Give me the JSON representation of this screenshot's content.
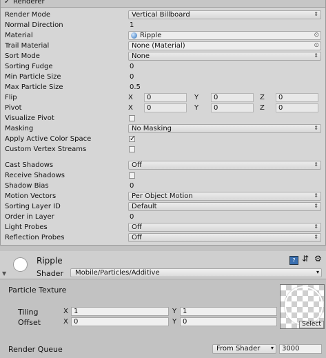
{
  "header": {
    "title": "Renderer",
    "checked": "✓"
  },
  "rows": [
    {
      "label": "Render Mode",
      "kind": "dropdown",
      "value": "Vertical Billboard"
    },
    {
      "label": "Normal Direction",
      "kind": "text",
      "value": "1"
    },
    {
      "label": "Material",
      "kind": "object",
      "value": "Ripple"
    },
    {
      "label": "Trail Material",
      "kind": "object",
      "value": "None (Material)"
    },
    {
      "label": "Sort Mode",
      "kind": "dropdown",
      "value": "None"
    },
    {
      "label": "Sorting Fudge",
      "kind": "text",
      "value": "0"
    },
    {
      "label": "Min Particle Size",
      "kind": "text",
      "value": "0"
    },
    {
      "label": "Max Particle Size",
      "kind": "text",
      "value": "0.5"
    },
    {
      "label": "Flip",
      "kind": "xyz",
      "x": "0",
      "y": "0",
      "z": "0"
    },
    {
      "label": "Pivot",
      "kind": "xyz",
      "x": "0",
      "y": "0",
      "z": "0"
    },
    {
      "label": "Visualize Pivot",
      "kind": "checkbox",
      "value": ""
    },
    {
      "label": "Masking",
      "kind": "dropdown",
      "value": "No Masking"
    },
    {
      "label": "Apply Active Color Space",
      "kind": "checkbox",
      "value": "✓"
    },
    {
      "label": "Custom Vertex Streams",
      "kind": "checkbox",
      "value": ""
    },
    {
      "label": "Cast Shadows",
      "kind": "dropdown",
      "value": "Off"
    },
    {
      "label": "Receive Shadows",
      "kind": "checkbox",
      "value": ""
    },
    {
      "label": "Shadow Bias",
      "kind": "text",
      "value": "0"
    },
    {
      "label": "Motion Vectors",
      "kind": "dropdown",
      "value": "Per Object Motion"
    },
    {
      "label": "Sorting Layer ID",
      "kind": "dropdown",
      "value": "Default"
    },
    {
      "label": "Order in Layer",
      "kind": "text",
      "value": "0"
    },
    {
      "label": "Light Probes",
      "kind": "dropdown",
      "value": "Off"
    },
    {
      "label": "Reflection Probes",
      "kind": "dropdown",
      "value": "Off"
    }
  ],
  "axis": {
    "x": "X",
    "y": "Y",
    "z": "Z"
  },
  "material": {
    "name": "Ripple",
    "shader_label": "Shader",
    "shader_value": "Mobile/Particles/Additive",
    "texture_label": "Particle Texture",
    "tiling_label": "Tiling",
    "tiling_x": "1",
    "tiling_y": "1",
    "offset_label": "Offset",
    "offset_x": "0",
    "offset_y": "0",
    "select_label": "Select",
    "render_queue_label": "Render Queue",
    "render_queue_mode": "From Shader",
    "render_queue_value": "3000"
  }
}
